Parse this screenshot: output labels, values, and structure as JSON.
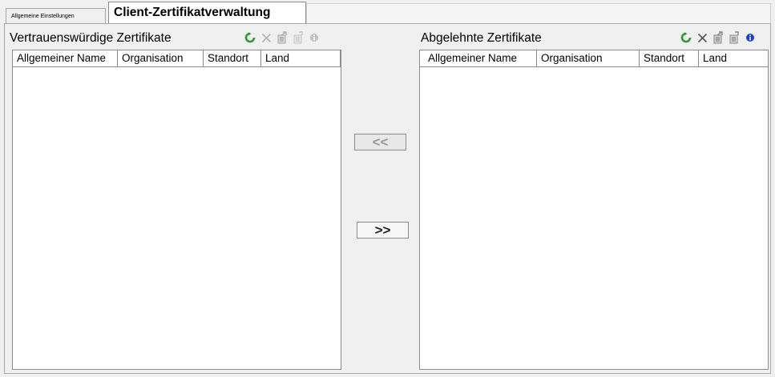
{
  "tabs": {
    "general": "Allgemeine Einstellungen",
    "client_certs": "Client-Zertifikatverwaltung"
  },
  "trusted": {
    "title": "Vertrauenswürdige Zertifikate",
    "columns": [
      "Allgemeiner Name",
      "Organisation",
      "Standort",
      "Land"
    ],
    "rows": [],
    "toolbar": [
      "refresh-icon",
      "delete-icon",
      "import-icon",
      "export-icon",
      "info-icon"
    ],
    "toolbar_state": "partially-disabled"
  },
  "rejected": {
    "title": "Abgelehnte Zertifikate",
    "columns": [
      "Allgemeiner Name",
      "Organisation",
      "Standort",
      "Land"
    ],
    "rows": [],
    "toolbar": [
      "refresh-icon",
      "delete-icon",
      "import-icon",
      "export-icon",
      "info-icon"
    ],
    "toolbar_state": "enabled"
  },
  "move_buttons": {
    "to_trusted": "<<",
    "to_rejected": ">>"
  },
  "colors": {
    "refresh": "#2e9a2e",
    "info": "#1a3fd6",
    "disabled": "#b4b4b4",
    "border": "#8c8c8c"
  }
}
